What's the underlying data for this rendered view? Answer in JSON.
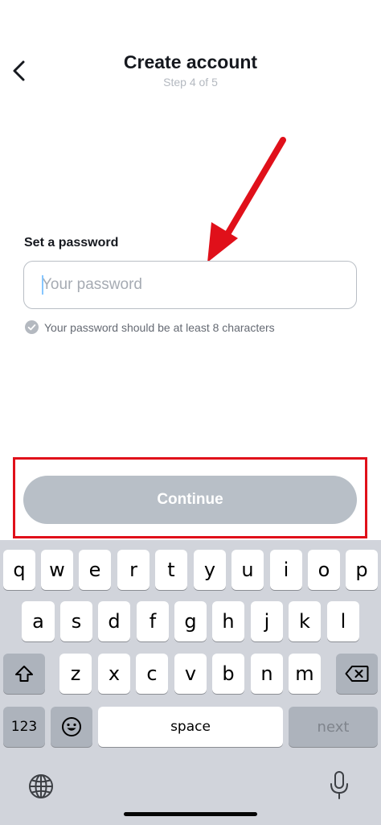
{
  "header": {
    "title": "Create account",
    "step": "Step 4 of 5"
  },
  "form": {
    "label": "Set a password",
    "placeholder": "Your password",
    "value": "",
    "hint": "Your password should be at least 8 characters"
  },
  "continue_label": "Continue",
  "keyboard": {
    "row1": [
      "q",
      "w",
      "e",
      "r",
      "t",
      "y",
      "u",
      "i",
      "o",
      "p"
    ],
    "row2": [
      "a",
      "s",
      "d",
      "f",
      "g",
      "h",
      "j",
      "k",
      "l"
    ],
    "row3": [
      "z",
      "x",
      "c",
      "v",
      "b",
      "n",
      "m"
    ],
    "numbers_label": "123",
    "space_label": "space",
    "next_label": "next"
  },
  "colors": {
    "annotation": "#e0101a",
    "button_disabled": "#b8bfc7",
    "keyboard_bg": "#d1d4db"
  }
}
